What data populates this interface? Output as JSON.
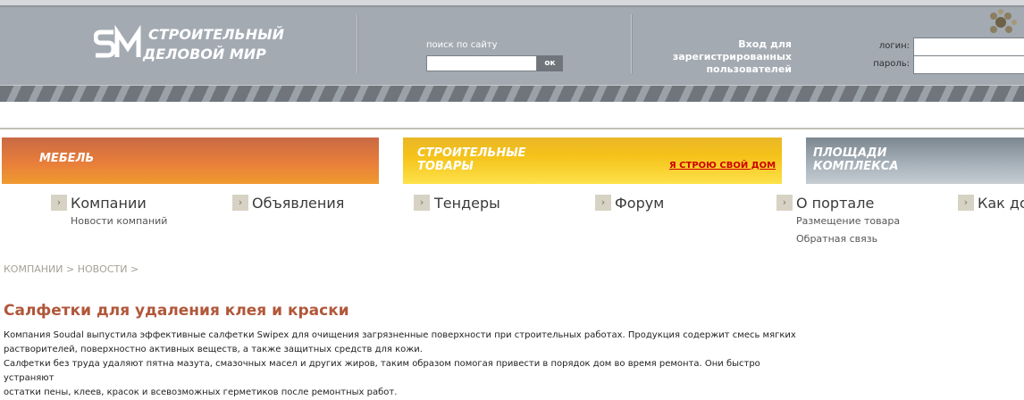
{
  "header": {
    "logo_line1": "СТРОИТЕЛЬНЫЙ",
    "logo_line2": "ДЕЛОВОЙ МИР",
    "search_label": "поиск по сайту",
    "search_value": "",
    "search_button": "ок",
    "login_info": [
      "Вход для",
      "зарегистрированных",
      "пользователей"
    ],
    "login_label": "логин:",
    "password_label": "пароль:"
  },
  "categories": [
    {
      "title": [
        "МЕБЕЛЬ"
      ]
    },
    {
      "title": [
        "СТРОИТЕЛЬНЫЕ",
        "ТОВАРЫ"
      ],
      "link": "Я СТРОЮ СВОЙ ДОМ"
    },
    {
      "title": [
        "ПЛОЩАДИ",
        "КОМПЛЕКСА"
      ]
    }
  ],
  "nav": [
    {
      "label": "Компании",
      "subs": [
        "Новости компаний"
      ]
    },
    {
      "label": "Объявления",
      "subs": []
    },
    {
      "label": "Тендеры",
      "subs": []
    },
    {
      "label": "Форум",
      "subs": []
    },
    {
      "label": "О портале",
      "subs": [
        "Размещение товара",
        "Обратная связь"
      ]
    },
    {
      "label": "Как до",
      "subs": []
    }
  ],
  "breadcrumb": "КОМПАНИИ > НОВОСТИ >",
  "article": {
    "title": "Салфетки для удаления клея и краски",
    "paragraphs": [
      [
        "Компания Soudal выпустила эффективные салфетки Swipex для очищения загрязненные поверхности при строительных работах. Продукция содержит смесь мягких",
        "растворителей, поверхностно активных веществ, а также защитных средств для кожи."
      ],
      [
        "Салфетки без труда удаляют пятна мазута, смазочных масел и других жиров, таким образом помогая привести в порядок дом во время ремонта. Они быстро устраняют",
        "остатки пены, клеев, красок и всевозможных герметиков после ремонтных работ."
      ]
    ]
  }
}
